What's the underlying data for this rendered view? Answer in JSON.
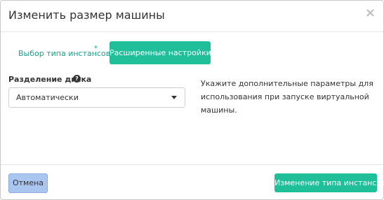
{
  "modal": {
    "title": "Изменить размер машины",
    "close_symbol": "×"
  },
  "tabs": [
    {
      "label": "Выбор типа инстансов",
      "required_mark": "*",
      "active": false
    },
    {
      "label": "Расширенные настройки",
      "active": true
    }
  ],
  "form": {
    "disk_partition": {
      "label": "Разделение диска",
      "help_icon": "question-circle-icon",
      "selected_value": "Автоматически"
    }
  },
  "help_text": "Укажите дополнительные параметры для использования при запуске виртуальной машины.",
  "footer": {
    "cancel_label": "Отмена",
    "submit_label": "Изменение типа инстансов"
  },
  "colors": {
    "accent": "#1fbf9a",
    "tab_link": "#1b9e8a",
    "cancel_bg": "#a9c5f0"
  }
}
